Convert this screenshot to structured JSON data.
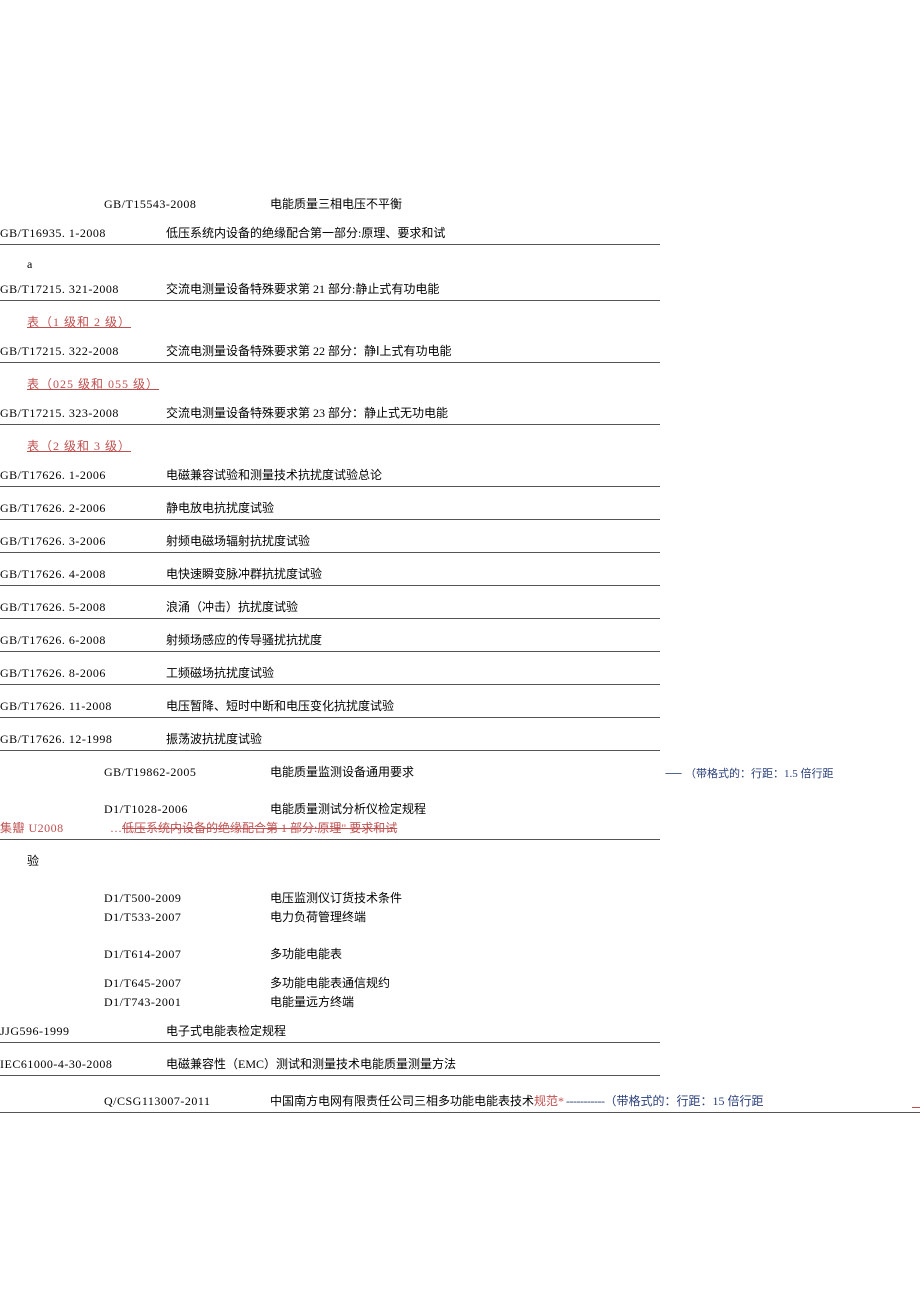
{
  "rows": {
    "r1": {
      "code": "GB/T15543-2008",
      "desc": "电能质量三相电压不平衡"
    },
    "r2": {
      "code": "GB/T16935. 1-2008",
      "desc": "低压系统内设备的绝缘配合第一部分:原理、要求和试"
    },
    "letterA": "a",
    "r3": {
      "code": "GB/T17215. 321-2008",
      "desc": "交流电测量设备特殊要求第 21 部分:静止式有功电能"
    },
    "cont3": "表（1 级和 2 级）",
    "r4": {
      "code": "GB/T17215. 322-2008",
      "desc": "交流电测量设备特殊要求第 22 部分：静Ⅰ上式有功电能"
    },
    "cont4": "表（025 级和 055 级）",
    "r5": {
      "code": "GB/T17215. 323-2008",
      "desc": "交流电测量设备特殊要求第 23 部分：静止式无功电能"
    },
    "cont5": "表（2 级和 3 级）",
    "r6": {
      "code": "GB/T17626. 1-2006",
      "desc": "电磁兼容试验和测量技术抗扰度试验总论"
    },
    "r7": {
      "code": "GB/T17626. 2-2006",
      "desc": "静电放电抗扰度试验"
    },
    "r8": {
      "code": "GB/T17626. 3-2006",
      "desc": "射频电磁场辐射抗扰度试验"
    },
    "r9": {
      "code": "GB/T17626. 4-2008",
      "desc": "电快速瞬变脉冲群抗扰度试验"
    },
    "r10": {
      "code": "GB/T17626. 5-2008",
      "desc": "浪涌（冲击）抗扰度试验"
    },
    "r11": {
      "code": "GB/T17626. 6-2008",
      "desc": "射频场感应的传导骚扰抗扰度"
    },
    "r12": {
      "code": "GB/T17626. 8-2006",
      "desc": "工频磁场抗扰度试验"
    },
    "r13": {
      "code": "GB/T17626. 11-2008",
      "desc": "电压暂降、短时中断和电压变化抗扰度试验"
    },
    "r14": {
      "code": "GB/T17626. 12-1998",
      "desc": "振荡波抗扰度试验"
    },
    "r15": {
      "code": "GB/T19862-2005",
      "desc": "电能质量监测设备通用要求"
    },
    "r16": {
      "code": "D1/T1028-2006",
      "desc": "电能质量测试分析仪检定规程"
    },
    "struck": {
      "code": "集瓣 U2008",
      "pre": "…",
      "desc": "低压系统内设备的绝缘配合第 1 部分:原理\" 要求和试"
    },
    "yan": "验",
    "r17": {
      "code": "D1/T500-2009",
      "desc": "电压监测仪订货技术条件"
    },
    "r18": {
      "code": "D1/T533-2007",
      "desc": "电力负荷管理终端"
    },
    "r19": {
      "code": "D1/T614-2007",
      "desc": "多功能电能表"
    },
    "r20": {
      "code": "D1/T645-2007",
      "desc": "多功能电能表通信规约"
    },
    "r21": {
      "code": "D1/T743-2001",
      "desc": "电能量远方终端"
    },
    "r22": {
      "code": "JJG596-1999",
      "desc": "电子式电能表检定规程"
    },
    "r23": {
      "code": "IEC61000-4-30-2008",
      "desc": "电磁兼容性（EMC）测试和测量技术电能质量测量方法"
    },
    "r24": {
      "code": "Q/CSG113007-2011",
      "desc": "中国南方电网有限责任公司三相多功能电能表技术",
      "norm": "规范*"
    }
  },
  "comments": {
    "c1": "（带格式的：行距：1.5 倍行距",
    "c2": "（带格式的：行距：15 倍行距"
  }
}
